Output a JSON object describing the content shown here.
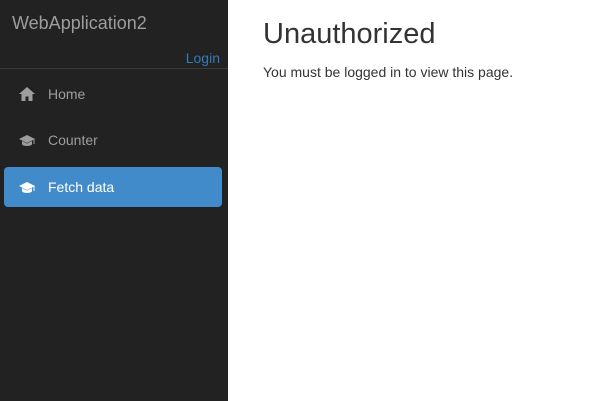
{
  "app": {
    "brand": "WebApplication2",
    "login_label": "Login"
  },
  "nav": {
    "items": [
      {
        "label": "Home",
        "icon": "home-icon",
        "active": false
      },
      {
        "label": "Counter",
        "icon": "graduation-cap-icon",
        "active": false
      },
      {
        "label": "Fetch data",
        "icon": "graduation-cap-icon",
        "active": true
      }
    ]
  },
  "main": {
    "title": "Unauthorized",
    "message": "You must be logged in to view this page."
  },
  "colors": {
    "sidebar_bg": "#222222",
    "active_bg": "#428bca",
    "link": "#337ab7",
    "muted_text": "#9d9d9d",
    "body_text": "#333333"
  }
}
